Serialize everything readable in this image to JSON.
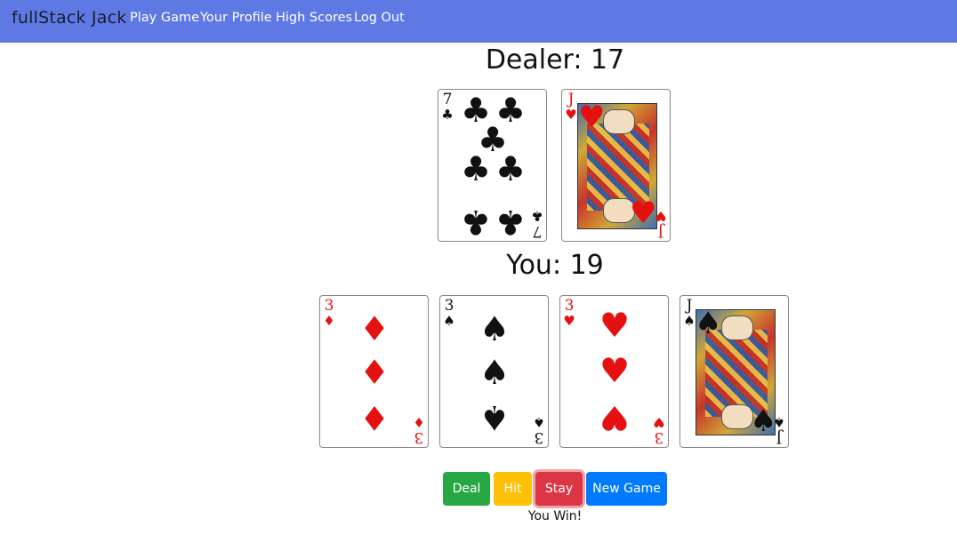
{
  "nav": {
    "brand": "fullStack Jack",
    "items": [
      "Play Game",
      "Your Profile",
      "High Scores",
      "Log Out"
    ]
  },
  "dealer": {
    "heading": "Dealer: 17",
    "cards": [
      {
        "rank": "7",
        "suit": "♣",
        "color": "black"
      },
      {
        "rank": "J",
        "suit": "♥",
        "color": "red"
      }
    ]
  },
  "player": {
    "heading": "You: 19",
    "cards": [
      {
        "rank": "3",
        "suit": "♦",
        "color": "red"
      },
      {
        "rank": "3",
        "suit": "♠",
        "color": "black"
      },
      {
        "rank": "3",
        "suit": "♥",
        "color": "red"
      },
      {
        "rank": "J",
        "suit": "♠",
        "color": "black"
      }
    ]
  },
  "buttons": {
    "deal": "Deal",
    "hit": "Hit",
    "stay": "Stay",
    "new_game": "New Game"
  },
  "colors": {
    "navbar": "#5f79e4",
    "deal": "#28a745",
    "hit": "#ffc107",
    "stay": "#dc3545",
    "new_game": "#007bff"
  },
  "result": "You Win!"
}
